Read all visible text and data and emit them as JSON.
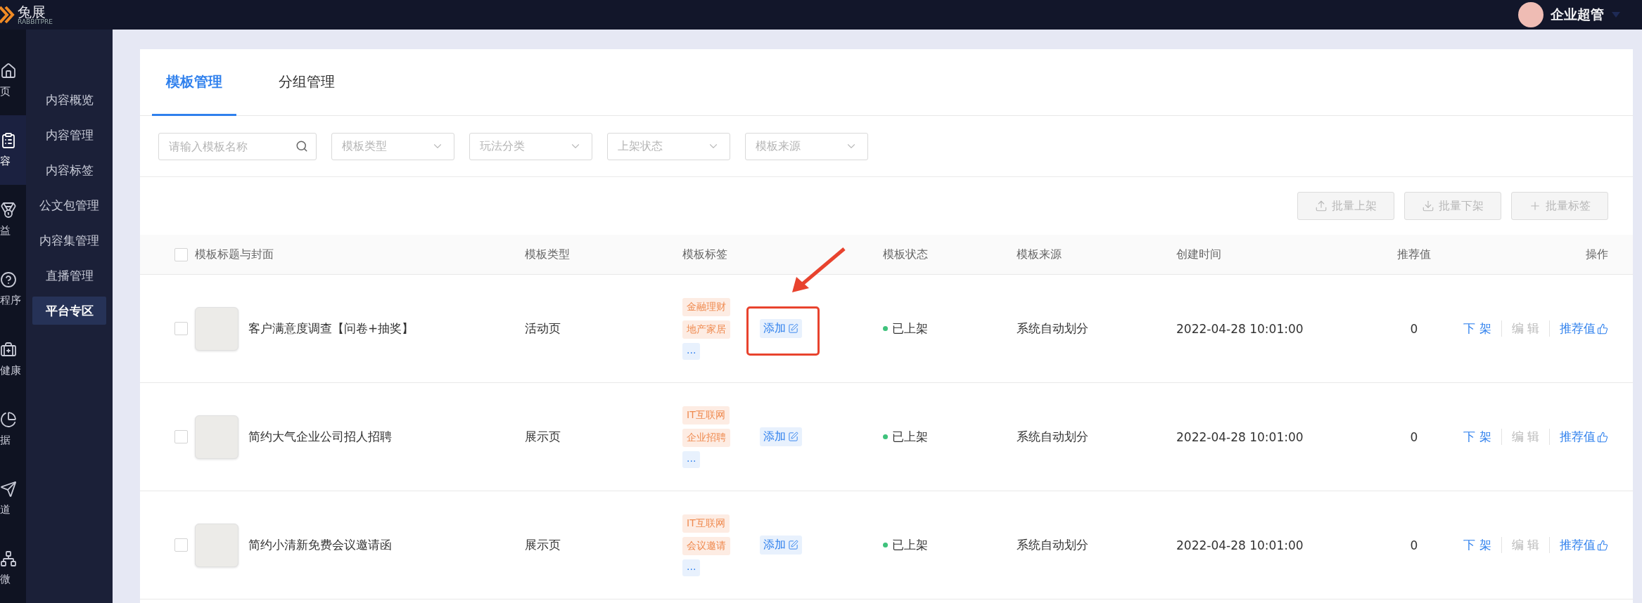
{
  "top_bar": {
    "logo": "兔展",
    "logo_sub": "RABBITPRE",
    "user": "企业超管"
  },
  "icon_rail": [
    {
      "kind": "home",
      "label": "页",
      "selected": false
    },
    {
      "kind": "clipboard",
      "label": "容",
      "selected": true
    },
    {
      "kind": "medal",
      "label": "益",
      "selected": false
    },
    {
      "kind": "help",
      "label": "程序",
      "selected": false
    },
    {
      "kind": "medkit",
      "label": "健康",
      "selected": false
    },
    {
      "kind": "pie",
      "label": "据",
      "selected": false
    },
    {
      "kind": "send",
      "label": "道",
      "selected": false
    },
    {
      "kind": "network",
      "label": "微",
      "selected": false
    }
  ],
  "menu": [
    {
      "label": "内容概览",
      "selected": false
    },
    {
      "label": "内容管理",
      "selected": false
    },
    {
      "label": "内容标签",
      "selected": false
    },
    {
      "label": "公文包管理",
      "selected": false
    },
    {
      "label": "内容集管理",
      "selected": false
    },
    {
      "label": "直播管理",
      "selected": false
    },
    {
      "label": "平台专区",
      "selected": true
    }
  ],
  "tabs": [
    {
      "label": "模板管理",
      "selected": true
    },
    {
      "label": "分组管理",
      "selected": false
    }
  ],
  "filters": {
    "search_placeholder": "请输入模板名称",
    "selects": [
      {
        "placeholder": "模板类型"
      },
      {
        "placeholder": "玩法分类"
      },
      {
        "placeholder": "上架状态"
      },
      {
        "placeholder": "模板来源"
      }
    ]
  },
  "bulk_actions": [
    {
      "kind": "upload",
      "label": "批量上架",
      "disabled": true
    },
    {
      "kind": "download",
      "label": "批量下架",
      "disabled": true
    },
    {
      "kind": "plus",
      "label": "批量标签",
      "disabled": true
    }
  ],
  "table": {
    "select_all_checked": false,
    "columns": [
      "模板标题与封面",
      "模板类型",
      "模板标签",
      "模板状态",
      "模板来源",
      "创建时间",
      "推荐值",
      "操作"
    ],
    "rows": [
      {
        "checked": false,
        "title": "客户满意度调查【问卷+抽奖】",
        "type": "活动页",
        "tags": [
          "金融理财",
          "地产家居"
        ],
        "more": "...",
        "add": "添加",
        "status": "已上架",
        "source": "系统自动划分",
        "created": "2022-04-28 10:01:00",
        "score": "0",
        "actions": [
          {
            "kind": "text",
            "label": "下 架",
            "disabled": false
          },
          {
            "kind": "text",
            "label": "编 辑",
            "disabled": true
          },
          {
            "kind": "like",
            "label": "推荐值",
            "disabled": false
          }
        ]
      },
      {
        "checked": false,
        "title": "简约大气企业公司招人招聘",
        "type": "展示页",
        "tags": [
          "IT互联网",
          "企业招聘"
        ],
        "more": "...",
        "add": "添加",
        "status": "已上架",
        "source": "系统自动划分",
        "created": "2022-04-28 10:01:00",
        "score": "0",
        "actions": [
          {
            "kind": "text",
            "label": "下 架",
            "disabled": false
          },
          {
            "kind": "text",
            "label": "编 辑",
            "disabled": true
          },
          {
            "kind": "like",
            "label": "推荐值",
            "disabled": false
          }
        ]
      },
      {
        "checked": false,
        "title": "简约小清新免费会议邀请函",
        "type": "展示页",
        "tags": [
          "IT互联网",
          "会议邀请"
        ],
        "more": "...",
        "add": "添加",
        "status": "已上架",
        "source": "系统自动划分",
        "created": "2022-04-28 10:01:00",
        "score": "0",
        "actions": [
          {
            "kind": "text",
            "label": "下 架",
            "disabled": false
          },
          {
            "kind": "text",
            "label": "编 辑",
            "disabled": true
          },
          {
            "kind": "like",
            "label": "推荐值",
            "disabled": false
          }
        ]
      }
    ]
  }
}
